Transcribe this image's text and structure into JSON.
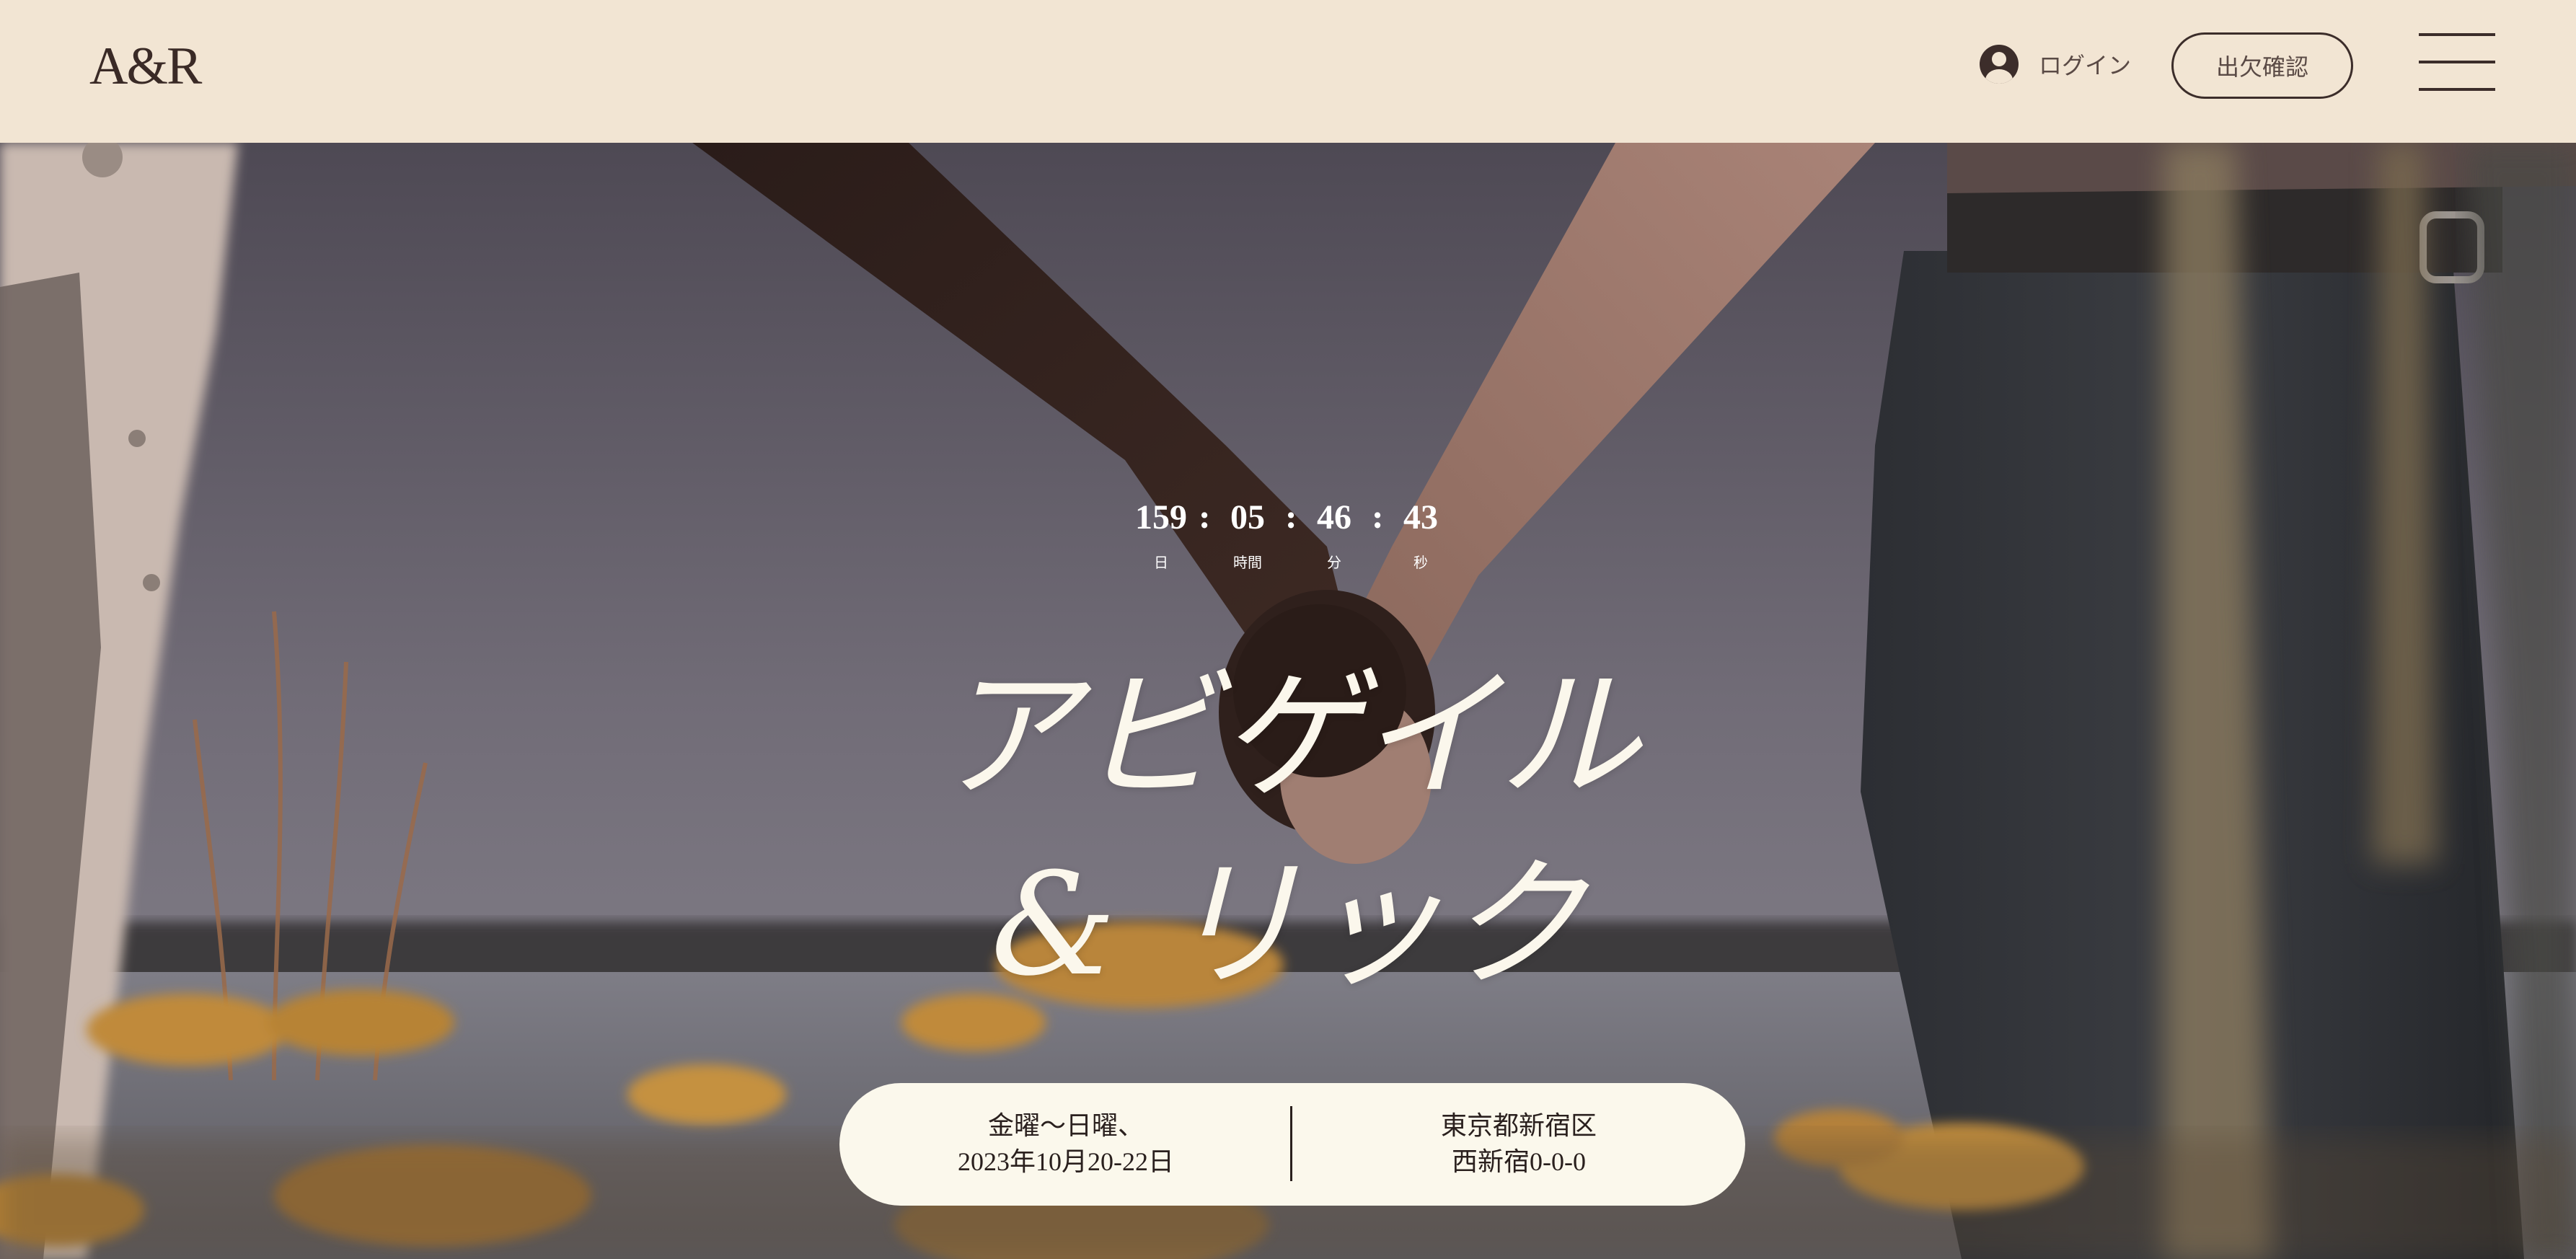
{
  "header": {
    "logo": "A&R",
    "login_label": "ログイン",
    "rsvp_label": "出欠確認",
    "background_color": "#f2e5d3"
  },
  "countdown": {
    "days": "159",
    "hours": "05",
    "minutes": "46",
    "seconds": "43",
    "separator": ":",
    "days_unit": "日",
    "hours_unit": "時間",
    "minutes_unit": "分",
    "seconds_unit": "秒"
  },
  "couple": {
    "line1": "アビゲイル",
    "line2": "& リック"
  },
  "event": {
    "date_line1": "金曜～日曜、",
    "date_line2": "2023年10月20-22日",
    "venue_line1": "東京都新宿区",
    "venue_line2": "西新宿0-0-0"
  },
  "icons": {
    "login": "user-circle-icon",
    "menu": "hamburger-menu-icon"
  },
  "colors": {
    "accent_dark": "#3c2d2a",
    "pill_background": "#fbf8ec",
    "title_text": "#fbf7ec"
  }
}
